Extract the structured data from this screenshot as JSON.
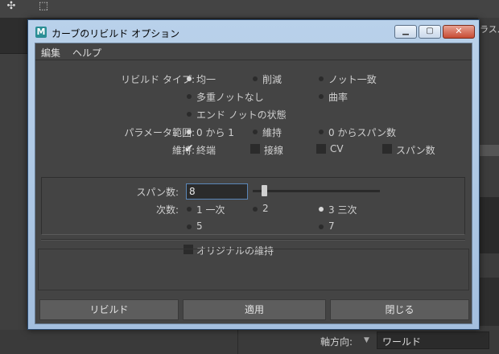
{
  "background": {
    "right_panel_text": "ラスル",
    "axis_label": "軸方向:",
    "axis_value": "ワールド"
  },
  "window": {
    "title": "カーブのリビルド オプション",
    "app_icon_letter": "M",
    "min_glyph": "▁",
    "max_glyph": "▢",
    "close_glyph": "✕"
  },
  "menu": {
    "items": [
      "編集",
      "ヘルプ"
    ]
  },
  "options": {
    "rebuild_type": {
      "label": "リビルド タイプ:",
      "choices": [
        "均一",
        "削減",
        "ノット一致",
        "多重ノットなし",
        "曲率",
        "エンド ノットの状態"
      ],
      "selected": "均一"
    },
    "param_range": {
      "label": "パラメータ範囲:",
      "choices": [
        "0 から 1",
        "維持",
        "0 からスパン数"
      ],
      "selected": "0 から 1"
    },
    "keep": {
      "label": "維持:",
      "choices": [
        "終端",
        "接線",
        "CV",
        "スパン数"
      ],
      "checked": [
        "終端"
      ]
    },
    "spans": {
      "label": "スパン数:",
      "value": "8",
      "slider_fraction": 0.07
    },
    "degree": {
      "label": "次数:",
      "choices": [
        "1 一次",
        "2",
        "3 三次",
        "5",
        "7"
      ],
      "selected": "3 三次"
    },
    "keep_original": {
      "label": "オリジナルの維持",
      "checked": false
    }
  },
  "buttons": {
    "rebuild": "リビルド",
    "apply": "適用",
    "close": "閉じる"
  }
}
